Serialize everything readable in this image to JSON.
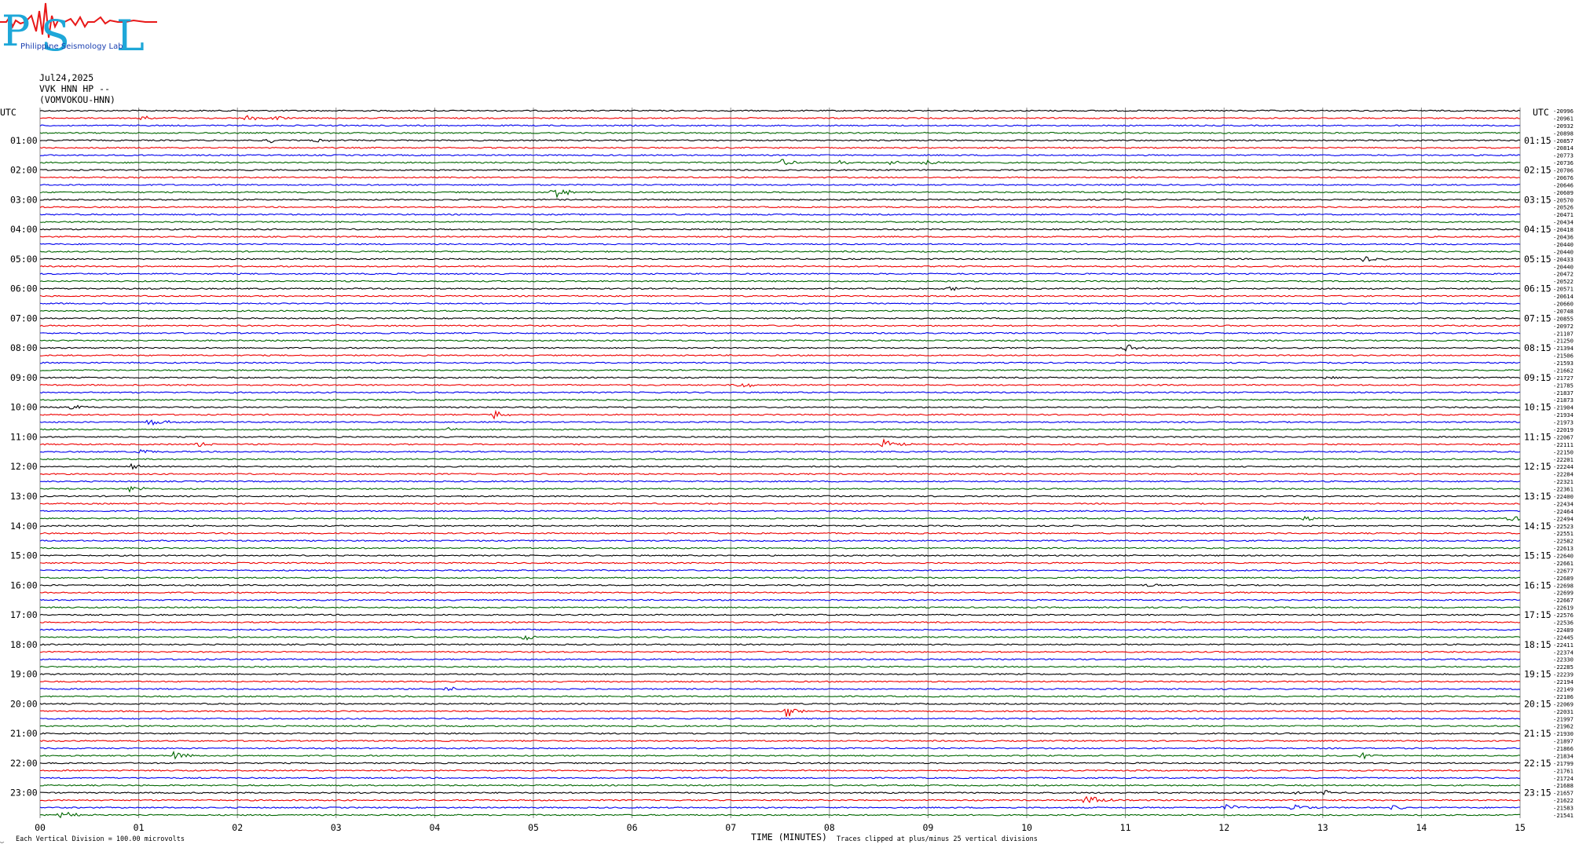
{
  "header": {
    "logo_letters": "PSL",
    "logo_text": "Philippine Seismology Lab",
    "date": "Jul24,2025",
    "channel": "VVK HNN HP --",
    "station": "(VOMVOKOU-HNN)"
  },
  "left_axis_title": "UTC",
  "right_axis_title": "UTC",
  "footer": {
    "xlabel": "TIME (MINUTES)",
    "scale_note": "Each Vertical Division = 100.00 microvolts",
    "clip_note": "Traces clipped at plus/minus 25 vertical divisions",
    "corner_mark": "‿"
  },
  "colors": {
    "trace_cycle": [
      "#000000",
      "#ee0000",
      "#0000ee",
      "#006600"
    ],
    "grid": "#888888"
  },
  "chart_data": {
    "type": "line",
    "title": "",
    "x_min": 0,
    "x_max": 15,
    "x_ticks": [
      "00",
      "01",
      "02",
      "03",
      "04",
      "05",
      "06",
      "07",
      "08",
      "09",
      "10",
      "11",
      "12",
      "13",
      "14",
      "15"
    ],
    "rows": 96,
    "row_minutes": 15,
    "left_hour_labels": [
      "01:00",
      "02:00",
      "03:00",
      "04:00",
      "05:00",
      "06:00",
      "07:00",
      "08:00",
      "09:00",
      "10:00",
      "11:00",
      "12:00",
      "13:00",
      "14:00",
      "15:00",
      "16:00",
      "17:00",
      "18:00",
      "19:00",
      "20:00",
      "21:00",
      "22:00",
      "23:00"
    ],
    "right_hour_labels": [
      "01:15",
      "02:15",
      "03:15",
      "04:15",
      "05:15",
      "06:15",
      "07:15",
      "08:15",
      "09:15",
      "10:15",
      "11:15",
      "12:15",
      "13:15",
      "14:15",
      "15:15",
      "16:15",
      "17:15",
      "18:15",
      "19:15",
      "20:15",
      "21:15",
      "22:15",
      "23:15"
    ],
    "offsets": [
      "-20996",
      "-20961",
      "-20932",
      "-20898",
      "-20857",
      "-20814",
      "-20773",
      "-20736",
      "-20706",
      "-20676",
      "-20646",
      "-20609",
      "-20570",
      "-20526",
      "-20471",
      "-20434",
      "-20418",
      "-20436",
      "-20440",
      "-20440",
      "-20433",
      "-20440",
      "-20472",
      "-20522",
      "-20571",
      "-20614",
      "-20660",
      "-20748",
      "-20855",
      "-20972",
      "-21107",
      "-21250",
      "-21394",
      "-21506",
      "-21593",
      "-21662",
      "-21727",
      "-21785",
      "-21837",
      "-21873",
      "-21904",
      "-21934",
      "-21973",
      "-22019",
      "-22067",
      "-22111",
      "-22150",
      "-22201",
      "-22244",
      "-22284",
      "-22321",
      "-22361",
      "-22400",
      "-22434",
      "-22464",
      "-22494",
      "-22523",
      "-22551",
      "-22582",
      "-22613",
      "-22640",
      "-22661",
      "-22677",
      "-22689",
      "-22698",
      "-22699",
      "-22667",
      "-22619",
      "-22576",
      "-22536",
      "-22489",
      "-22445",
      "-22411",
      "-22374",
      "-22330",
      "-22285",
      "-22239",
      "-22194",
      "-22149",
      "-22106",
      "-22069",
      "-22031",
      "-21997",
      "-21962",
      "-21930",
      "-21897",
      "-21866",
      "-21834",
      "-21799",
      "-21761",
      "-21724",
      "-21688",
      "-21657",
      "-21622",
      "-21583",
      "-21541"
    ],
    "events": [
      {
        "row": 1,
        "minute": 1.0,
        "amp": 4
      },
      {
        "row": 1,
        "minute": 2.1,
        "amp": 5
      },
      {
        "row": 1,
        "minute": 2.35,
        "amp": 3
      },
      {
        "row": 4,
        "minute": 2.3,
        "amp": 4
      },
      {
        "row": 4,
        "minute": 2.8,
        "amp": 3
      },
      {
        "row": 7,
        "minute": 7.5,
        "amp": 5
      },
      {
        "row": 7,
        "minute": 8.1,
        "amp": 3
      },
      {
        "row": 7,
        "minute": 8.6,
        "amp": 5
      },
      {
        "row": 7,
        "minute": 8.95,
        "amp": 5
      },
      {
        "row": 11,
        "minute": 5.2,
        "amp": 9
      },
      {
        "row": 20,
        "minute": 13.4,
        "amp": 5
      },
      {
        "row": 24,
        "minute": 9.2,
        "amp": 4
      },
      {
        "row": 29,
        "minute": 3.0,
        "amp": 3
      },
      {
        "row": 32,
        "minute": 11.0,
        "amp": 5
      },
      {
        "row": 36,
        "minute": 13.0,
        "amp": 3
      },
      {
        "row": 37,
        "minute": 7.1,
        "amp": 4
      },
      {
        "row": 40,
        "minute": 0.3,
        "amp": 4
      },
      {
        "row": 41,
        "minute": 4.6,
        "amp": 6
      },
      {
        "row": 42,
        "minute": 1.1,
        "amp": 7
      },
      {
        "row": 43,
        "minute": 4.1,
        "amp": 3
      },
      {
        "row": 45,
        "minute": 8.55,
        "amp": 6
      },
      {
        "row": 45,
        "minute": 1.6,
        "amp": 4
      },
      {
        "row": 46,
        "minute": 1.0,
        "amp": 5
      },
      {
        "row": 48,
        "minute": 0.9,
        "amp": 4
      },
      {
        "row": 51,
        "minute": 0.9,
        "amp": 5
      },
      {
        "row": 55,
        "minute": 12.8,
        "amp": 5
      },
      {
        "row": 55,
        "minute": 14.9,
        "amp": 5
      },
      {
        "row": 64,
        "minute": 11.2,
        "amp": 3
      },
      {
        "row": 71,
        "minute": 4.9,
        "amp": 5
      },
      {
        "row": 78,
        "minute": 4.1,
        "amp": 4
      },
      {
        "row": 81,
        "minute": 7.55,
        "amp": 10
      },
      {
        "row": 87,
        "minute": 1.35,
        "amp": 6
      },
      {
        "row": 87,
        "minute": 13.4,
        "amp": 4
      },
      {
        "row": 92,
        "minute": 12.7,
        "amp": 4
      },
      {
        "row": 92,
        "minute": 13.0,
        "amp": 4
      },
      {
        "row": 93,
        "minute": 10.6,
        "amp": 10
      },
      {
        "row": 94,
        "minute": 12.0,
        "amp": 5
      },
      {
        "row": 94,
        "minute": 12.7,
        "amp": 5
      },
      {
        "row": 94,
        "minute": 13.7,
        "amp": 4
      },
      {
        "row": 95,
        "minute": 0.2,
        "amp": 6
      }
    ]
  }
}
